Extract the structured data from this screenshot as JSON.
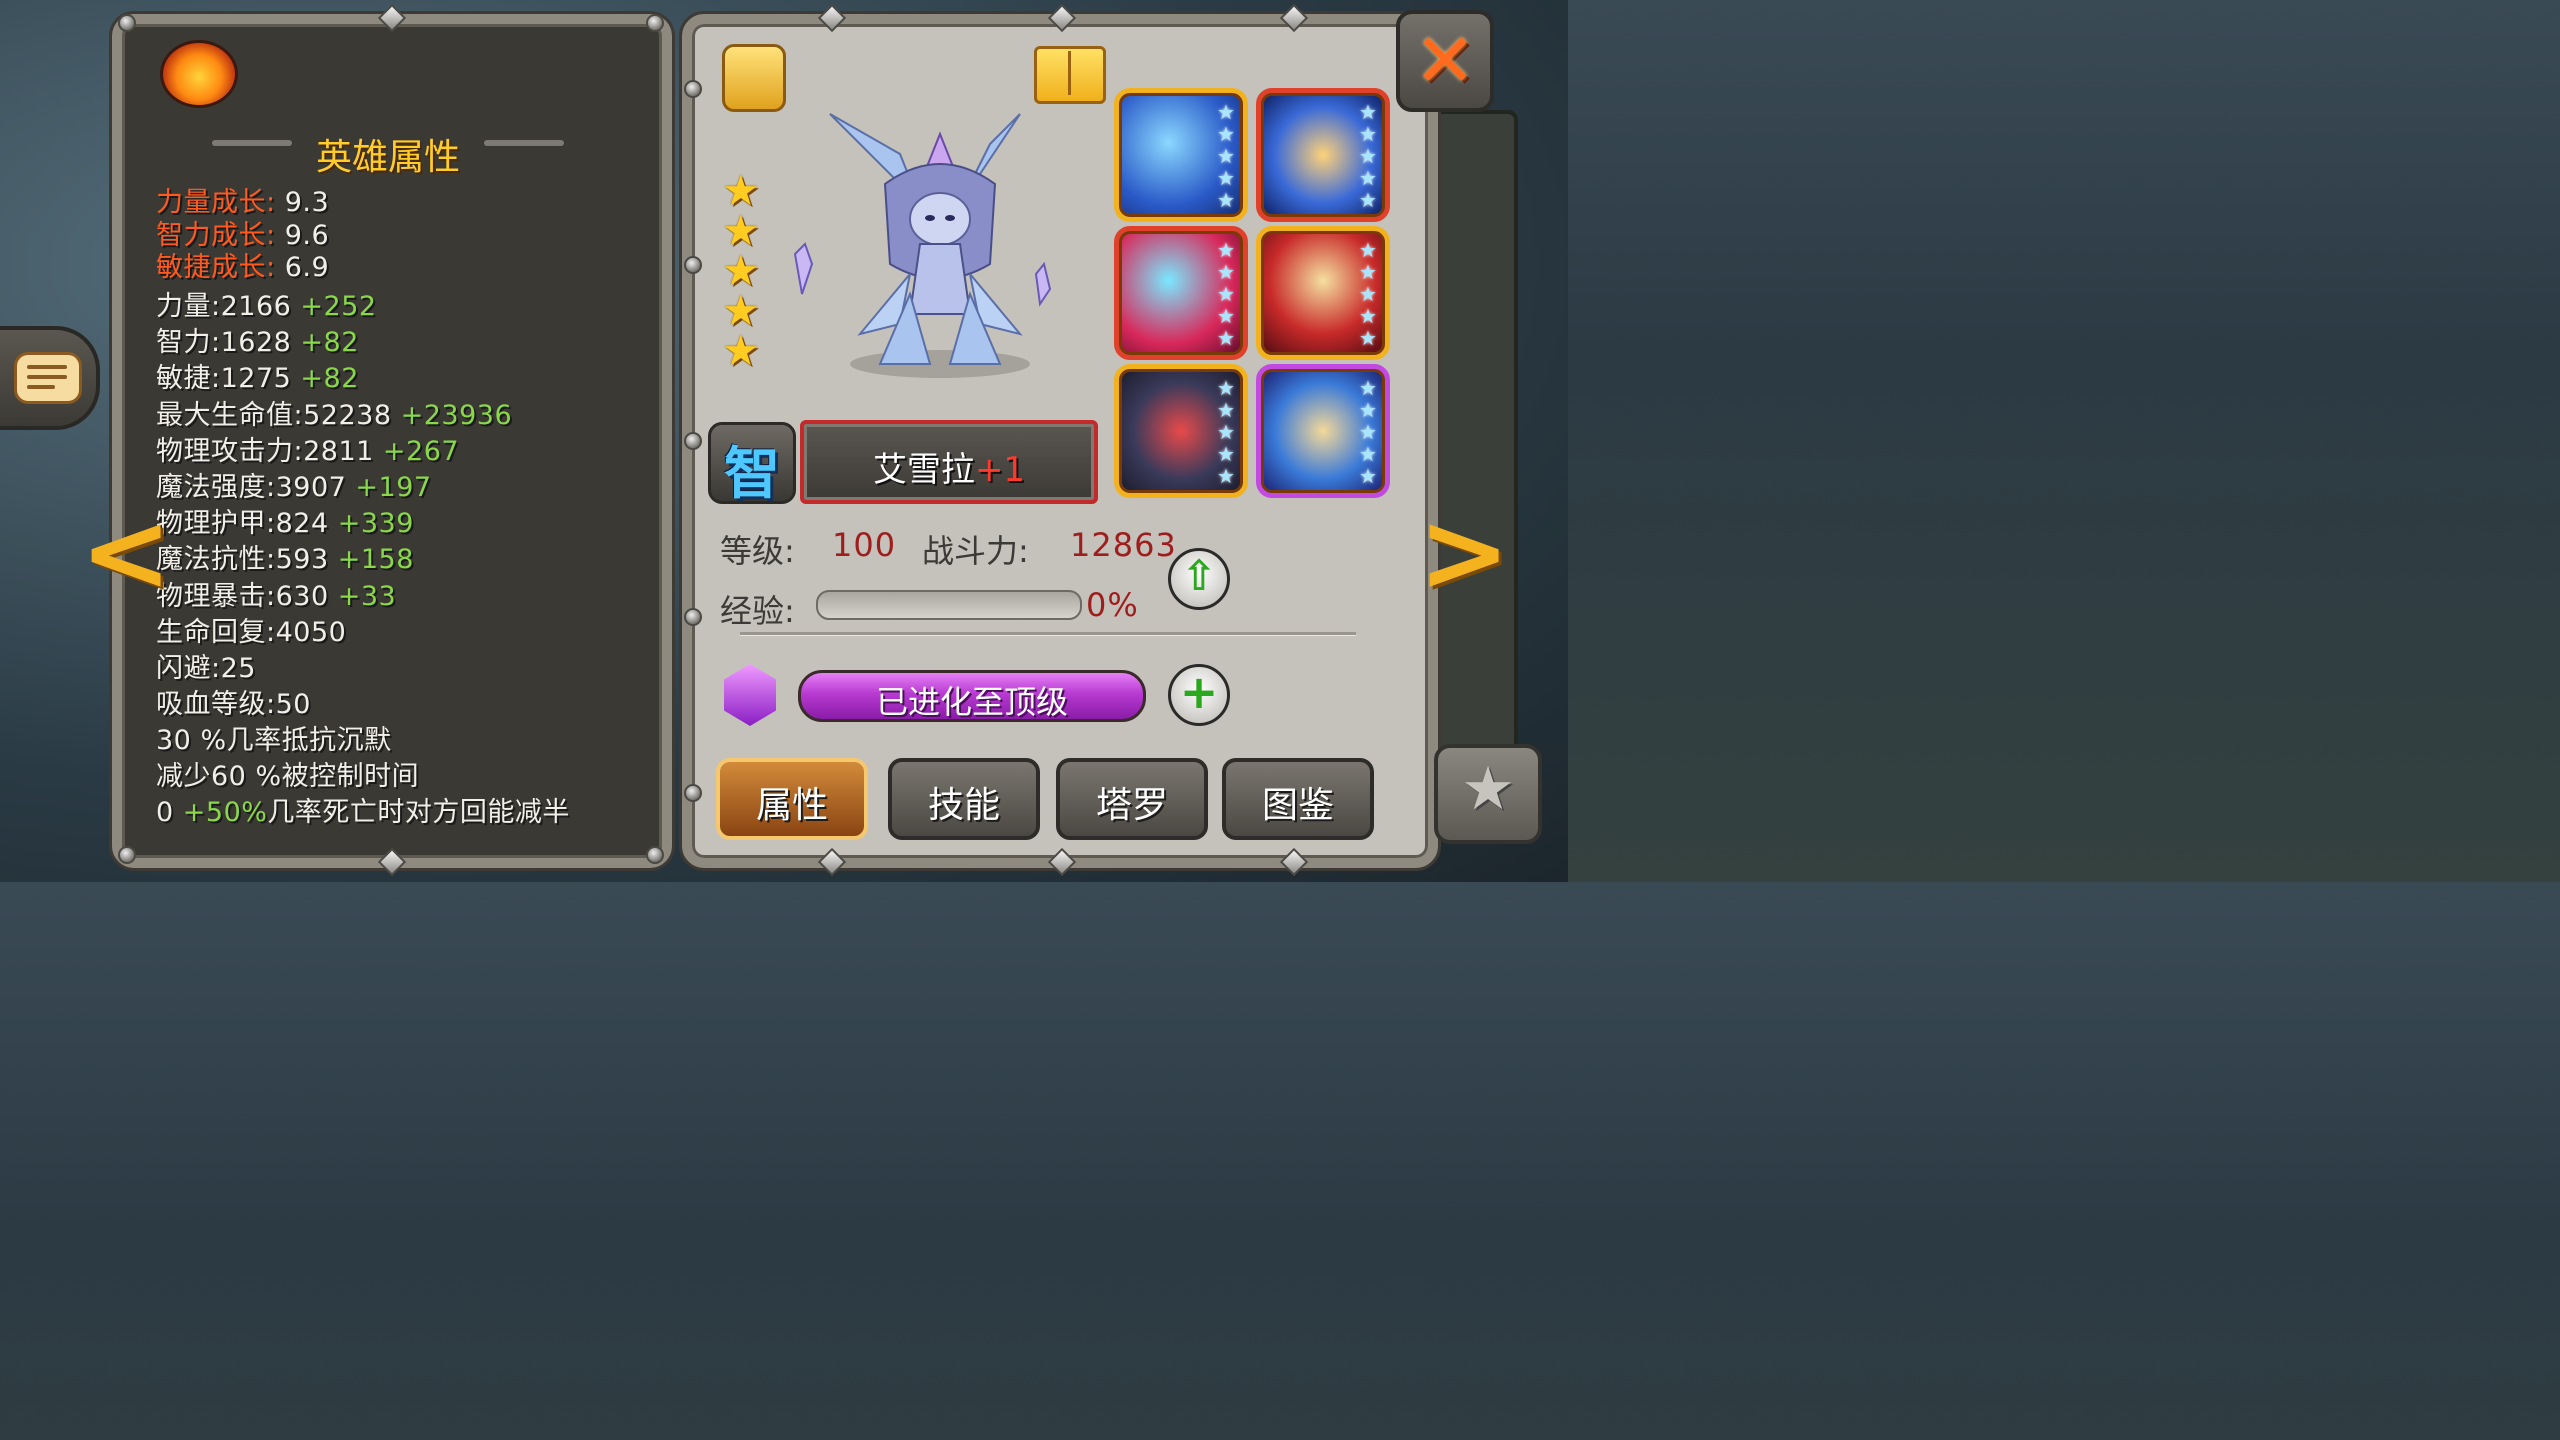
{
  "panel_title": "英雄属性",
  "growth": [
    {
      "label": "力量成长:",
      "value": "9.3"
    },
    {
      "label": "智力成长:",
      "value": "9.6"
    },
    {
      "label": "敏捷成长:",
      "value": "6.9"
    }
  ],
  "stats": [
    {
      "label": "力量:",
      "value": "2166",
      "bonus": "+252"
    },
    {
      "label": "智力:",
      "value": "1628",
      "bonus": "+82"
    },
    {
      "label": "敏捷:",
      "value": "1275",
      "bonus": "+82"
    },
    {
      "label": "最大生命值:",
      "value": "52238",
      "bonus": "+23936"
    },
    {
      "label": "物理攻击力:",
      "value": "2811",
      "bonus": "+267"
    },
    {
      "label": "魔法强度:",
      "value": "3907",
      "bonus": "+197"
    },
    {
      "label": "物理护甲:",
      "value": "824",
      "bonus": "+339"
    },
    {
      "label": "魔法抗性:",
      "value": "593",
      "bonus": "+158"
    },
    {
      "label": "物理暴击:",
      "value": "630",
      "bonus": "+33"
    },
    {
      "label": "生命回复:",
      "value": "4050",
      "bonus": ""
    },
    {
      "label": "闪避:",
      "value": "25",
      "bonus": ""
    },
    {
      "label": "吸血等级:",
      "value": "50",
      "bonus": ""
    }
  ],
  "passives": [
    {
      "prefix": "",
      "bonus": "",
      "text": "30 %几率抵抗沉默"
    },
    {
      "prefix": "",
      "bonus": "",
      "text": "减少60 %被控制时间"
    },
    {
      "prefix": "0 ",
      "bonus": "+50%",
      "text": "几率死亡时对方回能减半"
    }
  ],
  "hero": {
    "type_glyph": "智",
    "name": "艾雪拉",
    "plus": "+1",
    "stars": 5,
    "level_label": "等级:",
    "level": "100",
    "power_label": "战斗力:",
    "power": "12863",
    "exp_label": "经验:",
    "exp_percent": "0%",
    "exp_fraction": 0.0,
    "evolve_text": "已进化至顶级"
  },
  "equipment": [
    {
      "name": "ice-wings",
      "stars": 5
    },
    {
      "name": "winged-armor",
      "stars": 5
    },
    {
      "name": "ice-gauntlet",
      "stars": 5
    },
    {
      "name": "royal-mantle",
      "stars": 5
    },
    {
      "name": "heart-shield",
      "stars": 5
    },
    {
      "name": "winged-boots",
      "stars": 5
    }
  ],
  "tabs": [
    "属性",
    "技能",
    "塔罗",
    "图鉴"
  ],
  "icons": {
    "close": "close-icon",
    "chat": "chat-icon",
    "prev": "arrow-left-icon",
    "next": "arrow-right-icon",
    "favorite": "star-icon",
    "armor": "armor-icon",
    "book": "book-icon",
    "flame": "flame-icon",
    "gem": "gem-icon"
  },
  "colors": {
    "growth_label": "#ff5a1e",
    "bonus": "#8ad84a",
    "value_red": "#9e1e1e",
    "evolve": "#b83ad2",
    "slot_border_gold": "#f2b21e",
    "slot_border_purple": "#c34ae0",
    "slot_border_red": "#e0412a"
  }
}
